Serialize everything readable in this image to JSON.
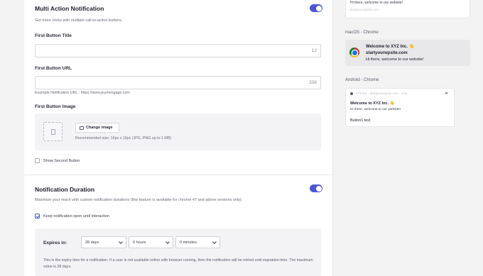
{
  "multi_action": {
    "title": "Multi Action Notification",
    "description": "Get more clicks with multiple call-to-action buttons.",
    "toggle_on": true,
    "first_button_title_label": "First Button Title",
    "first_button_title_counter": "12",
    "first_button_url_label": "First Button URL",
    "first_button_url_counter": "256",
    "example_url": "Example Notification URL : https://www.pushengage.com",
    "first_button_image_label": "First Button Image",
    "change_image_label": "Change image",
    "recommended_size": "Recommended size: 16px x 16px (JPG, PNG up to 1 MB)",
    "show_second_button_label": "Show Second Button",
    "show_second_button_checked": false
  },
  "duration": {
    "title": "Notification Duration",
    "description": "Maximize your reach with custom notification durations (this feature is available for chrome 47 and above versions only).",
    "toggle_on": true,
    "keep_open_label": "Keep notification open until interaction",
    "keep_open_checked": true,
    "expires_label": "Expires in:",
    "days": "28 days",
    "hours": "0 hours",
    "minutes": "0 minutes",
    "help": "This is the expiry time for a notification. If a user is not available online with browser running, then the notification will be retried until expiration time. The maximum value is 28 days."
  },
  "preview": {
    "top_message": "Hi there, welcome to our website!",
    "top_site": "startyourwpsite.com",
    "mac_label": "macOS - Chrome",
    "mac_title": "Welcome to XYZ Inc. 👋",
    "mac_site": "startyourwpsite.com",
    "mac_message": "Hi there, welcome to our website!",
    "android_label": "Android - Chrome",
    "android_site": "Chrome · startyourwpsite.com · now",
    "android_title": "Welcome to XYZ Inc. 👋",
    "android_message": "Hi there, welcome to our website!",
    "android_button": "Button1 text"
  },
  "colors": {
    "accent": "#4a56d6",
    "card": "#ffffff",
    "page_bg": "#f3f3f4"
  }
}
